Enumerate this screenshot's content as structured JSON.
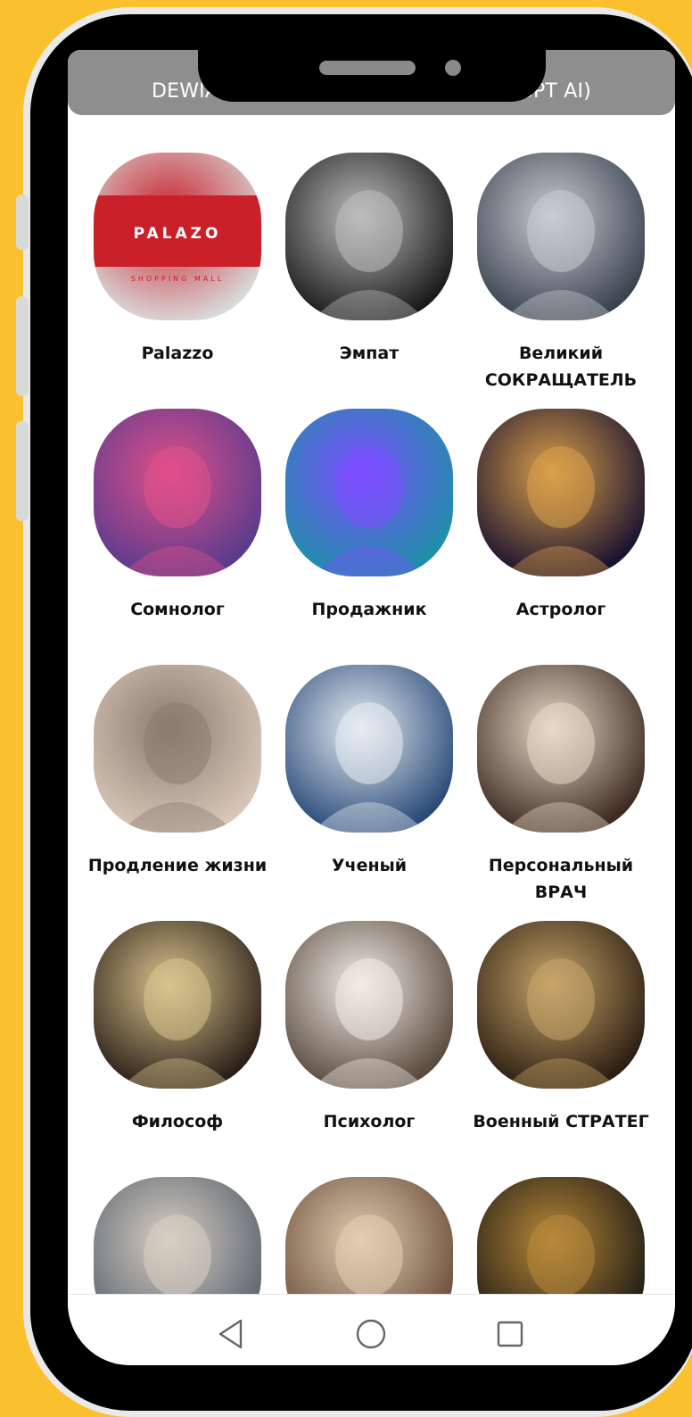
{
  "app": {
    "title": "DEWIAR Ассистент (на основе ChatGPT AI)"
  },
  "assistants": [
    {
      "label": "Palazzo",
      "icon": "palazzo-logo-icon",
      "palette": [
        "#d9d9d9",
        "#c9202a"
      ]
    },
    {
      "label": "Эмпат",
      "icon": "eye-portrait-icon",
      "palette": [
        "#1a1a1a",
        "#bdbdbd"
      ]
    },
    {
      "label": "Великий\nСОКРАЩАТЕЛЬ",
      "icon": "robot-head-icon",
      "palette": [
        "#3a4350",
        "#c9ccd2"
      ]
    },
    {
      "label": "Сомнолог",
      "icon": "dreaming-woman-icon",
      "palette": [
        "#5b3b8c",
        "#e0508a"
      ]
    },
    {
      "label": "Продажник",
      "icon": "isometric-store-icon",
      "palette": [
        "#1f8fa8",
        "#7c4dff"
      ]
    },
    {
      "label": "Астролог",
      "icon": "astrologer-woman-icon",
      "palette": [
        "#1b1230",
        "#d9a04a"
      ]
    },
    {
      "label": "Продление жизни",
      "icon": "young-old-face-icon",
      "palette": [
        "#d8c7b8",
        "#8a7b70"
      ]
    },
    {
      "label": "Ученый",
      "icon": "scientist-icon",
      "palette": [
        "#284a78",
        "#e8ecf2"
      ]
    },
    {
      "label": "Персональный\nВРАЧ",
      "icon": "doctor-woman-icon",
      "palette": [
        "#3d2b22",
        "#e8d9c9"
      ]
    },
    {
      "label": "Философ",
      "icon": "old-philosopher-icon",
      "palette": [
        "#2a1f17",
        "#d8c48e"
      ]
    },
    {
      "label": "Психолог",
      "icon": "psychologist-woman-icon",
      "palette": [
        "#5a4a3e",
        "#f2ece6"
      ]
    },
    {
      "label": "Военный СТРАТЕГ",
      "icon": "old-strategist-icon",
      "palette": [
        "#2b1e12",
        "#c8a56a"
      ]
    },
    {
      "label": "",
      "icon": "praying-figure-icon",
      "palette": [
        "#5b6470",
        "#d8cfc2"
      ]
    },
    {
      "label": "",
      "icon": "helping-hands-icon",
      "palette": [
        "#6a4e3a",
        "#e3cdb2"
      ]
    },
    {
      "label": "",
      "icon": "golden-mask-icon",
      "palette": [
        "#1e1a14",
        "#b8893a"
      ]
    }
  ],
  "nav": {
    "back": "back-icon",
    "home": "home-icon",
    "recents": "recents-icon"
  },
  "colors": {
    "background": "#FBC02D",
    "title_bar": "#8e8e8e",
    "label_text": "#111111"
  }
}
